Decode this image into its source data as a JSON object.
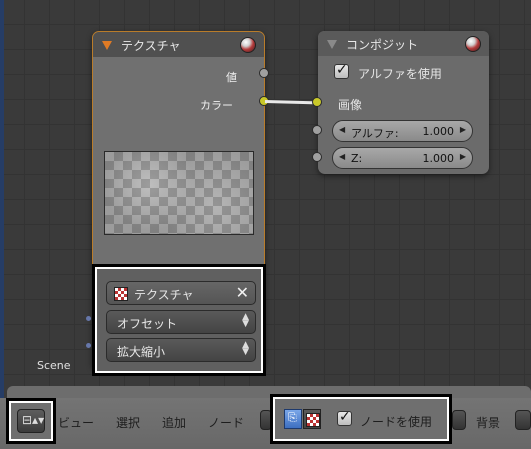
{
  "texture_node": {
    "title": "テクスチャ",
    "outputs": [
      "値",
      "カラー"
    ],
    "texture_field": "テクスチャ",
    "offset_dropdown": "オフセット",
    "scale_dropdown": "拡大縮小"
  },
  "composite_node": {
    "title": "コンポジット",
    "use_alpha_label": "アルファを使用",
    "use_alpha_checked": true,
    "image_input": "画像",
    "alpha_field": {
      "label": "アルファ:",
      "value": "1.000"
    },
    "z_field": {
      "label": "Z:",
      "value": "1.000"
    }
  },
  "scene_label": "Scene",
  "header": {
    "menus": [
      "ビュー",
      "選択",
      "追加",
      "ノード"
    ],
    "use_nodes_label": "ノードを使用",
    "use_nodes_checked": true,
    "backdrop_label": "背景"
  },
  "colors": {
    "node_link": "#e9e9e9",
    "socket_color": "#c8c829",
    "socket_value": "#a0a0a0",
    "texture_accent": "#e07b25",
    "active_toggle": "#3d6fc1"
  },
  "icons": [
    "node-collapse-triangle-icon",
    "material-sphere-icon",
    "checker-texture-icon",
    "close-x-icon",
    "up-down-arrows-icon",
    "node-editor-icon",
    "compositing-nodes-icon",
    "texture-nodes-icon"
  ]
}
